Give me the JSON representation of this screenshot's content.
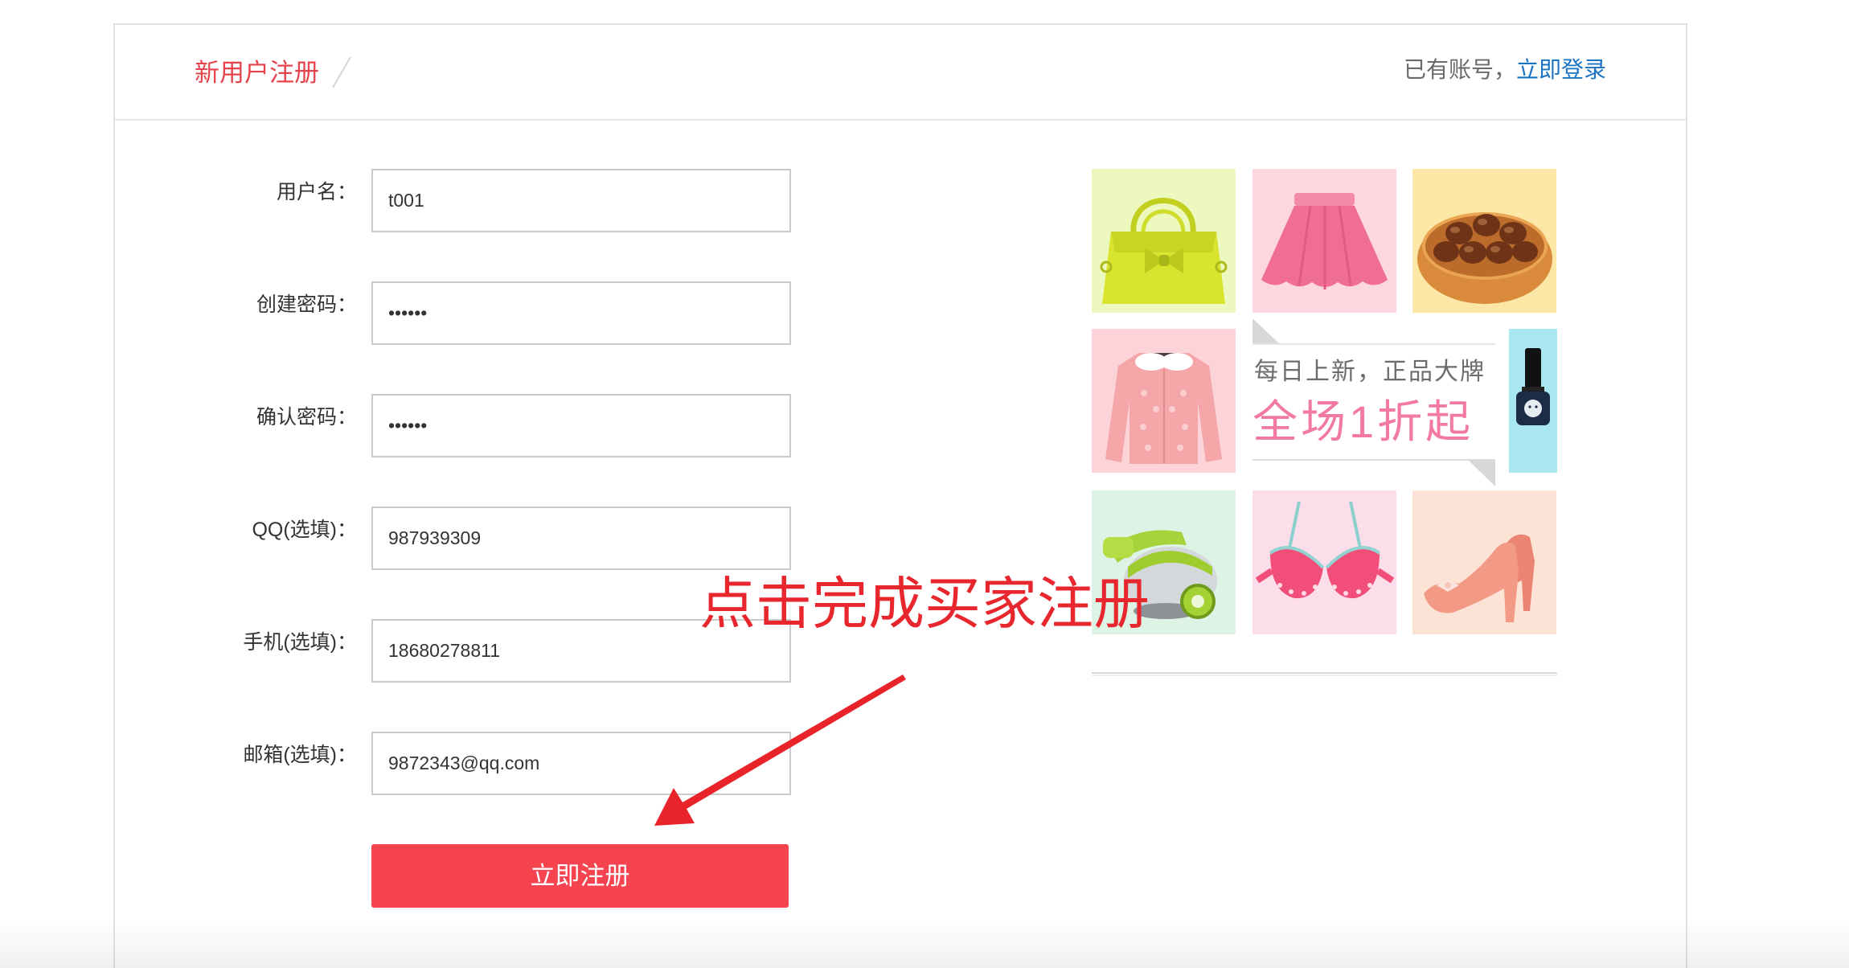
{
  "header": {
    "title": "新用户注册",
    "login_prompt": "已有账号，",
    "login_link": "立即登录"
  },
  "form": {
    "fields": [
      {
        "label": "用户名：",
        "value": "t001"
      },
      {
        "label": "创建密码：",
        "value": "••••••"
      },
      {
        "label": "确认密码：",
        "value": "••••••"
      },
      {
        "label": "QQ(选填)：",
        "value": "987939309"
      },
      {
        "label": "手机(选填)：",
        "value": "18680278811"
      },
      {
        "label": "邮箱(选填)：",
        "value": "9872343@qq.com"
      }
    ],
    "submit_label": "立即注册"
  },
  "promo": {
    "tiles": [
      {
        "image": "handbag-image",
        "bg": "#ecf8bd"
      },
      {
        "image": "skirt-image",
        "bg": "#fcd7df"
      },
      {
        "image": "walnuts-image",
        "bg": "#fde7a7"
      },
      {
        "image": "cardigan-image",
        "bg": "#fbd3d9"
      },
      {
        "image": "nail-polish-image",
        "bg": "#a9e7f1"
      },
      {
        "image": "vacuum-cleaner-image",
        "bg": "#ddf3e6"
      },
      {
        "image": "bra-image",
        "bg": "#fbdee9"
      },
      {
        "image": "high-heels-image",
        "bg": "#fde3d6"
      }
    ],
    "banner": {
      "line1": "每日上新，正品大牌",
      "line2": "全场1折起"
    }
  },
  "annotation": {
    "text": "点击完成买家注册",
    "arrow": "red-arrow-icon"
  },
  "colors": {
    "title_red": "#e6434c",
    "link_blue": "#1a73c3",
    "button_red": "#f5434f",
    "annotation_red": "#e8262d",
    "banner_pink": "#f27aa1"
  }
}
